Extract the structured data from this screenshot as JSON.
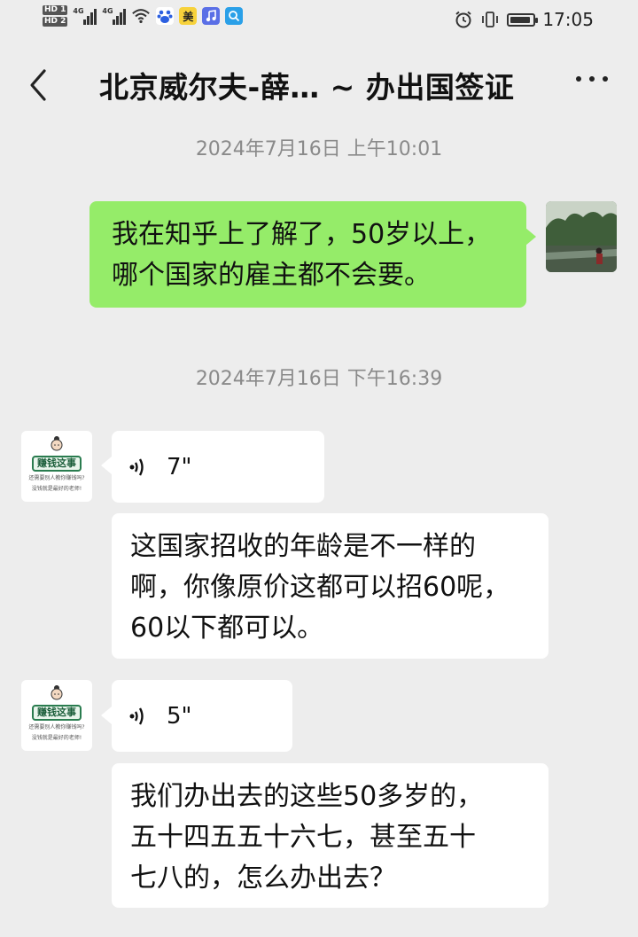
{
  "status_bar": {
    "sim1": "HD 1",
    "sim2": "HD 2",
    "net1": "4G",
    "net2": "4G",
    "app_meituan": "美",
    "time": "17:05",
    "battery_level": 0.9
  },
  "header": {
    "title": "北京威尔夫-薛… ~ 办出国签证"
  },
  "messages": [
    {
      "type": "timestamp",
      "text": "2024年7月16日 上午10:01"
    },
    {
      "type": "text",
      "sender": "self",
      "lines": [
        "我在知乎上了解了，50岁以上，",
        "哪个国家的雇主都不会要。"
      ]
    },
    {
      "type": "timestamp",
      "text": "2024年7月16日 下午16:39"
    },
    {
      "type": "voice",
      "sender": "other",
      "duration": "7\""
    },
    {
      "type": "text",
      "sender": "other",
      "lines": [
        "这国家招收的年龄是不一样的",
        "啊，你像原价这都可以招60呢，",
        "60以下都可以。"
      ]
    },
    {
      "type": "voice",
      "sender": "other",
      "duration": "5\""
    },
    {
      "type": "text",
      "sender": "other",
      "lines": [
        "我们办出去的这些50多岁的，",
        "五十四五五十六七，甚至五十",
        "七八的，怎么办出去？"
      ]
    }
  ],
  "avatar_other": {
    "banner": "赚钱这事",
    "sub1": "还需要别人教你赚钱吗?",
    "sub2": "没钱就是最好的老师!"
  },
  "colors": {
    "background": "#ededed",
    "self_bubble": "#95ec69",
    "other_bubble": "#ffffff",
    "timestamp": "#8a8a8a"
  }
}
